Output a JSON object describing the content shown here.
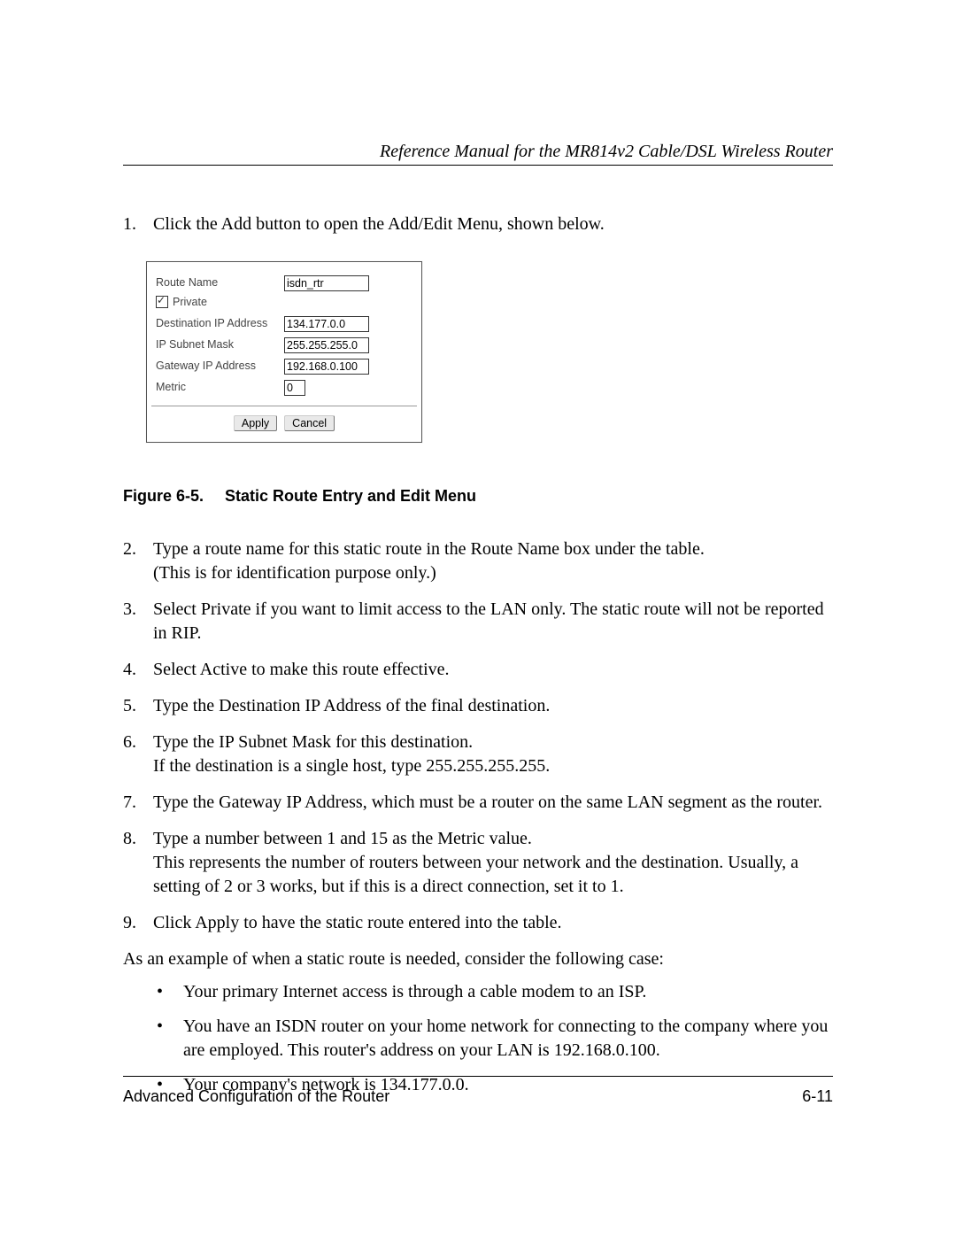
{
  "header_title": "Reference Manual for the MR814v2 Cable/DSL Wireless Router",
  "ui": {
    "route_name_label": "Route Name",
    "route_name_value": "isdn_rtr",
    "private_label": "Private",
    "private_checked": true,
    "dest_ip_label": "Destination IP Address",
    "dest_ip_value": "134.177.0.0",
    "subnet_label": "IP Subnet Mask",
    "subnet_value": "255.255.255.0",
    "gateway_label": "Gateway IP Address",
    "gateway_value": "192.168.0.100",
    "metric_label": "Metric",
    "metric_value": "0",
    "apply_label": "Apply",
    "cancel_label": "Cancel"
  },
  "figure": {
    "number": "Figure 6-5.",
    "title": "Static Route Entry and Edit Menu"
  },
  "steps": {
    "s1": "Click the Add button to open the Add/Edit Menu, shown below.",
    "s2a": "Type a route name for this static route in the Route Name box under the table.",
    "s2b": "(This is for identification purpose only.)",
    "s3": "Select Private if you want to limit access to the LAN only. The static route will not be reported in RIP.",
    "s4": "Select Active to make this route effective.",
    "s5": "Type the Destination IP Address of the final destination.",
    "s6a": "Type the IP Subnet Mask for this destination.",
    "s6b": "If the destination is a single host, type 255.255.255.255.",
    "s7": "Type the Gateway IP Address, which must be a router on the same LAN segment as the router.",
    "s8a": "Type a number between 1 and 15 as the Metric value.",
    "s8b": "This represents the number of routers between your network and the destination. Usually, a setting of 2 or 3 works, but if this is a direct connection, set it to 1.",
    "s9": "Click Apply to have the static route entered into the table."
  },
  "example_intro": "As an example of when a static route is needed, consider the following case:",
  "example_bullets": {
    "b1": "Your primary Internet access is through a cable modem to an ISP.",
    "b2": "You have an ISDN router on your home network for connecting to the company where you are employed. This router's address on your LAN is 192.168.0.100.",
    "b3": "Your company's network is 134.177.0.0."
  },
  "footer_left": "Advanced Configuration of the Router",
  "footer_right": "6-11"
}
